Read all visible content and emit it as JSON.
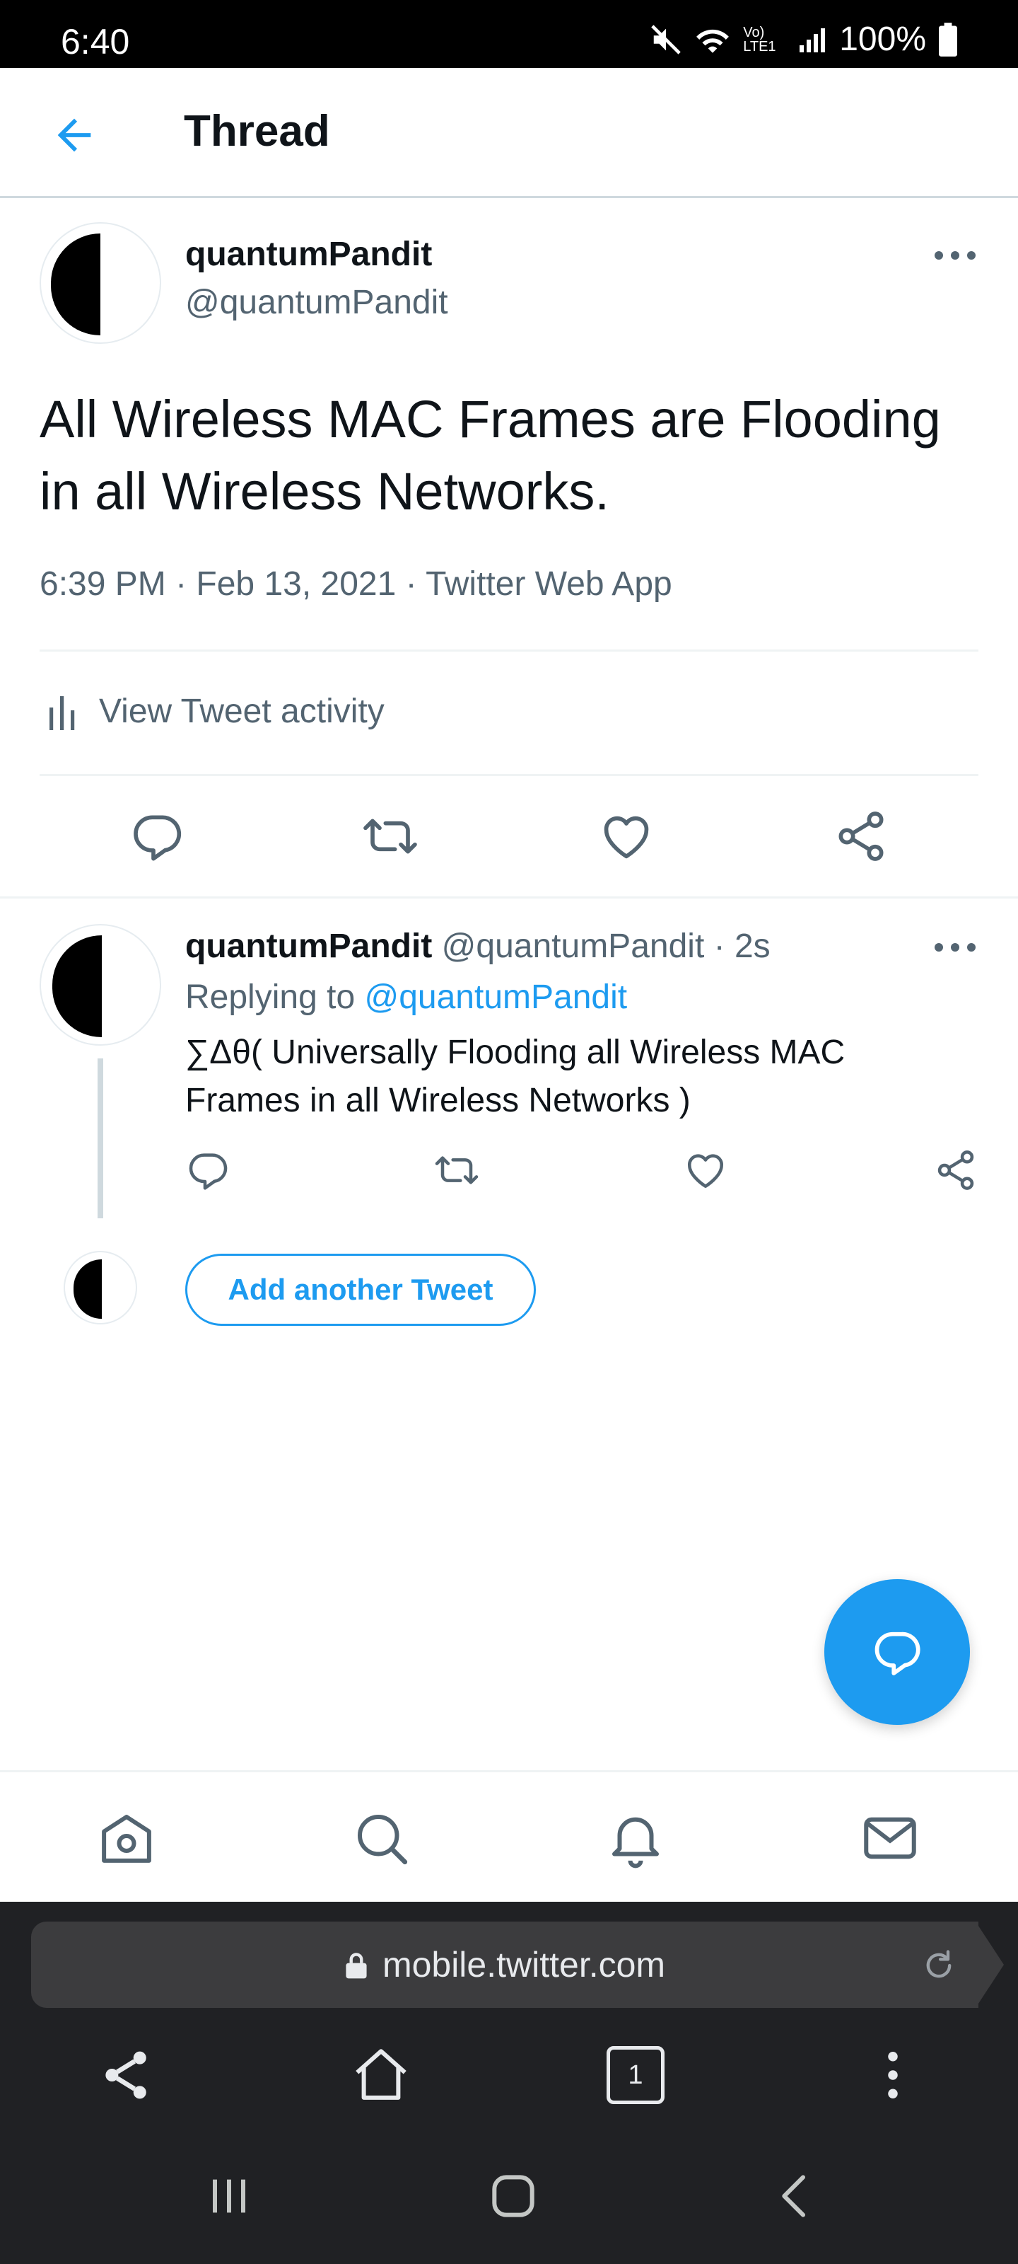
{
  "status_bar": {
    "time": "6:40",
    "battery": "100%",
    "network": "Vo) LTE1"
  },
  "header": {
    "title": "Thread"
  },
  "main_tweet": {
    "name": "quantumPandit",
    "handle": "@quantumPandit",
    "text": "All Wireless MAC Frames are Flooding in all Wireless Networks.",
    "meta": "6:39 PM · Feb 13, 2021 · Twitter Web App",
    "activity_label": "View Tweet activity"
  },
  "reply_tweet": {
    "name": "quantumPandit",
    "handle": "@quantumPandit",
    "time": "· 2s",
    "replying_prefix": "Replying to",
    "replying_handle": "@quantumPandit",
    "text": "∑Δθ( Universally Flooding all Wireless MAC Frames in all Wireless Networks )"
  },
  "add_tweet": {
    "label": "Add another Tweet"
  },
  "browser": {
    "url": "mobile.twitter.com",
    "tab_count": "1"
  },
  "colors": {
    "accent": "#1d9bf0",
    "text": "#0f1419",
    "muted": "#536471",
    "divider": "#eff3f4"
  },
  "icons": {
    "bottom_nav": [
      "home-icon",
      "search-icon",
      "notifications-icon",
      "messages-icon"
    ],
    "actions": [
      "reply-icon",
      "retweet-icon",
      "like-icon",
      "share-icon"
    ]
  }
}
